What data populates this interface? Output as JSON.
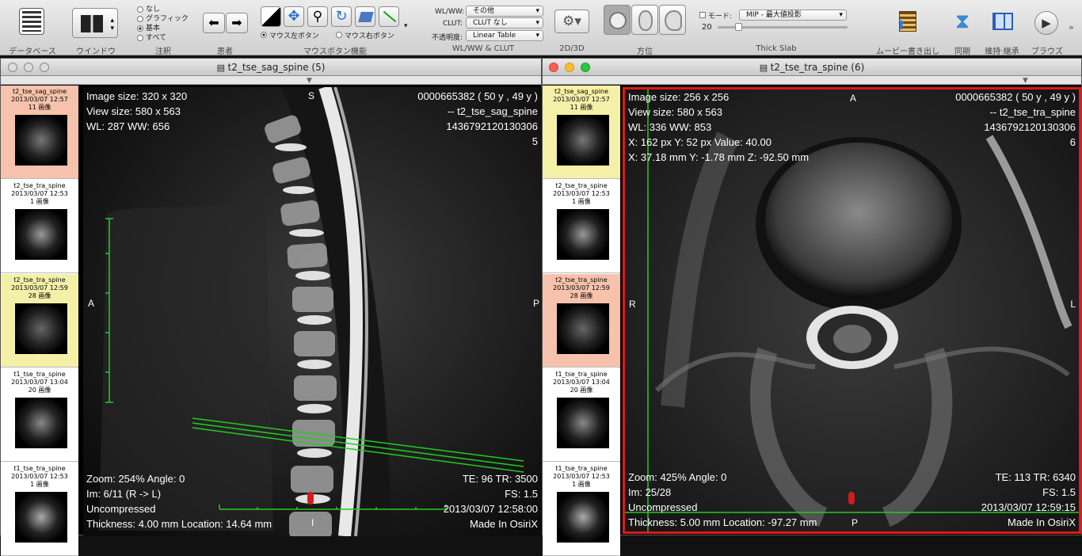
{
  "toolbar": {
    "database_label": "データベース",
    "window_label": "ウインドウ",
    "annotation_label": "注釈",
    "annotation_options": [
      "なし",
      "グラフィック",
      "基本",
      "すべて"
    ],
    "patient_label": "患者",
    "mouse_label": "マウスボタン機能",
    "mouse_left": "マウス左ボタン",
    "mouse_right": "マウス右ボタン",
    "wlww_group_label": "WL/WW & CLUT",
    "wlww_label": "WL/WW:",
    "wlww_value": "その他",
    "clut_label": "CLUT:",
    "clut_value": "CLUT なし",
    "opacity_label": "不透明度:",
    "opacity_value": "Linear Table",
    "twod3d_label": "2D/3D",
    "orientation_label": "方位",
    "mode_label": "モード:",
    "mode_value": "MIP - 最大値投影",
    "slab_value": "20",
    "thickslab_label": "Thick Slab",
    "movie_label": "ムービー書き出し",
    "sync_label": "同期",
    "tile_label": "維持·継承",
    "browse_label": "ブラウズ"
  },
  "left_window": {
    "title": "t2_tse_sag_spine (5)",
    "thumbnails": [
      {
        "name": "t2_tse_sag_spine",
        "date": "2013/03/07 12:57",
        "count": "11 画像",
        "bg": "#f7c2ab"
      },
      {
        "name": "t2_tse_tra_spine",
        "date": "2013/03/07 12:53",
        "count": "1 画像",
        "bg": "#ffffff"
      },
      {
        "name": "t2_tse_tra_spine",
        "date": "2013/03/07 12:59",
        "count": "28 画像",
        "bg": "#f5f0a8"
      },
      {
        "name": "t1_tse_tra_spine",
        "date": "2013/03/07 13:04",
        "count": "20 画像",
        "bg": "#ffffff"
      },
      {
        "name": "t1_tse_tra_spine",
        "date": "2013/03/07 12:53",
        "count": "1 画像",
        "bg": "#ffffff"
      }
    ],
    "tl": [
      "Image size: 320 x 320",
      "View size: 580 x 563",
      "WL: 287 WW: 656"
    ],
    "tr": [
      "0000665382 (  50 y ,  49 y )",
      "-- t2_tse_sag_spine",
      "1436792120130306",
      "5"
    ],
    "bl": [
      "Zoom: 254% Angle: 0",
      "Im: 6/11  (R -> L)",
      "Uncompressed",
      "Thickness: 4.00 mm Location: 14.64 mm"
    ],
    "br": [
      "TE:  96 TR:  3500",
      "FS:  1.5",
      "2013/03/07 12:58:00",
      "Made In OsiriX"
    ],
    "ori_top": "S",
    "ori_left": "A",
    "ori_right": "P",
    "ori_bottom": "I"
  },
  "right_window": {
    "title": "t2_tse_tra_spine (6)",
    "thumbnails": [
      {
        "name": "t2_tse_sag_spine",
        "date": "2013/03/07 12:57",
        "count": "11 画像",
        "bg": "#f5f0a8"
      },
      {
        "name": "t2_tse_tra_spine",
        "date": "2013/03/07 12:53",
        "count": "1 画像",
        "bg": "#ffffff"
      },
      {
        "name": "t2_tse_tra_spine",
        "date": "2013/03/07 12:59",
        "count": "28 画像",
        "bg": "#f7c2ab"
      },
      {
        "name": "t1_tse_tra_spine",
        "date": "2013/03/07 13:04",
        "count": "20 画像",
        "bg": "#ffffff"
      },
      {
        "name": "t1_tse_tra_spine",
        "date": "2013/03/07 12:53",
        "count": "1 画像",
        "bg": "#ffffff"
      }
    ],
    "tl": [
      "Image size: 256 x 256",
      "View size: 580 x 563",
      "WL: 336 WW: 853",
      "X: 162 px Y: 52 px Value: 40.00",
      "X: 37.18 mm Y: -1.78 mm Z: -92.50 mm"
    ],
    "tr": [
      "0000665382 (  50 y ,  49 y )",
      "-- t2_tse_tra_spine",
      "1436792120130306",
      "6"
    ],
    "bl": [
      "Zoom: 425% Angle: 0",
      "Im: 25/28",
      "Uncompressed",
      "Thickness: 5.00 mm Location: -97.27 mm"
    ],
    "br": [
      "TE:  113 TR:  6340",
      "FS:  1.5",
      "2013/03/07 12:59:15",
      "Made In OsiriX"
    ],
    "ori_top": "A",
    "ori_left": "R",
    "ori_right": "L",
    "ori_bottom": "P"
  },
  "colors": {
    "active_border": "#e01818",
    "scout_line": "#22cc22",
    "selected_thumb": "#f7c2ab",
    "marked_thumb": "#f5f0a8"
  }
}
